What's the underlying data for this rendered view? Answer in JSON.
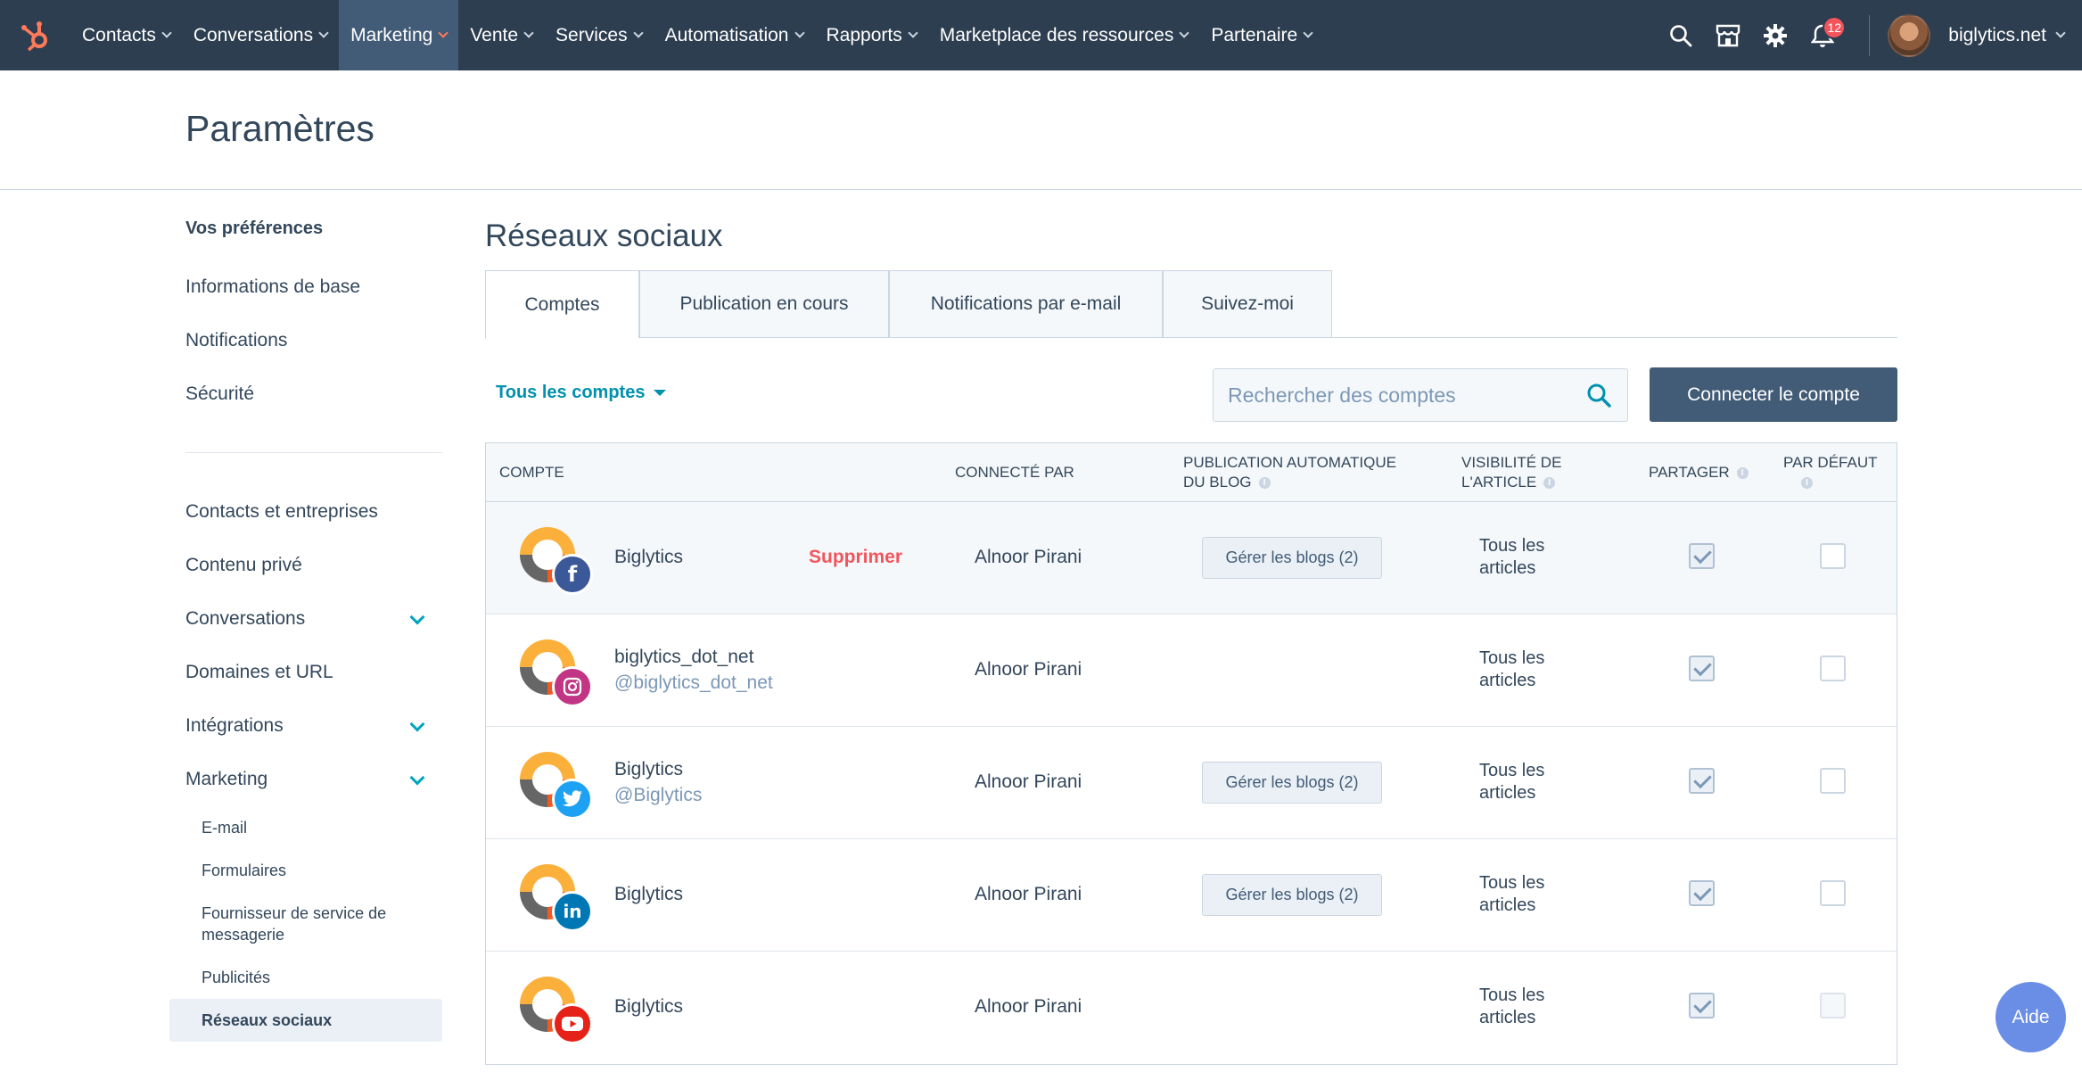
{
  "topnav": {
    "items": [
      {
        "label": "Contacts"
      },
      {
        "label": "Conversations"
      },
      {
        "label": "Marketing"
      },
      {
        "label": "Vente"
      },
      {
        "label": "Services"
      },
      {
        "label": "Automatisation"
      },
      {
        "label": "Rapports"
      },
      {
        "label": "Marketplace des ressources"
      },
      {
        "label": "Partenaire"
      }
    ],
    "active_item": "Marketing",
    "notification_count": "12",
    "account_name": "biglytics.net"
  },
  "header": {
    "title": "Paramètres"
  },
  "sidebar": {
    "section_title": "Vos préférences",
    "items": [
      {
        "label": "Informations de base"
      },
      {
        "label": "Notifications"
      },
      {
        "label": "Sécurité"
      },
      {
        "label": "Contacts et entreprises"
      },
      {
        "label": "Contenu privé"
      },
      {
        "label": "Conversations"
      },
      {
        "label": "Domaines et URL"
      },
      {
        "label": "Intégrations"
      },
      {
        "label": "Marketing"
      }
    ],
    "sub_items": [
      {
        "label": "E-mail"
      },
      {
        "label": "Formulaires"
      },
      {
        "label": "Fournisseur de service de messagerie"
      },
      {
        "label": "Publicités"
      },
      {
        "label": "Réseaux sociaux"
      }
    ],
    "active_sub_item": "Réseaux sociaux"
  },
  "main": {
    "section_title": "Réseaux sociaux",
    "tabs": [
      {
        "label": "Comptes"
      },
      {
        "label": "Publication en cours"
      },
      {
        "label": "Notifications par e-mail"
      },
      {
        "label": "Suivez-moi"
      }
    ],
    "active_tab": "Comptes",
    "filter_label": "Tous les comptes",
    "search_placeholder": "Rechercher des comptes",
    "connect_button": "Connecter le compte",
    "table": {
      "headers": {
        "account": "COMPTE",
        "connected_by": "CONNECTÉ PAR",
        "auto_publish_line1": "PUBLICATION AUTOMATIQUE",
        "auto_publish_line2": "DU BLOG",
        "visibility_line1": "VISIBILITÉ DE",
        "visibility_line2": "L'ARTICLE",
        "share": "PARTAGER",
        "default": "PAR DÉFAUT"
      },
      "rows": [
        {
          "network": "facebook",
          "name": "Biglytics",
          "handle": "",
          "remove": "Supprimer",
          "connected_by": "Alnoor Pirani",
          "blogs": "Gérer les blogs (2)",
          "visibility_line1": "Tous les",
          "visibility_line2": "articles",
          "share": true,
          "default": false
        },
        {
          "network": "instagram",
          "name": "biglytics_dot_net",
          "handle": "@biglytics_dot_net",
          "remove": "",
          "connected_by": "Alnoor Pirani",
          "blogs": "",
          "visibility_line1": "Tous les",
          "visibility_line2": "articles",
          "share": true,
          "default": false
        },
        {
          "network": "twitter",
          "name": "Biglytics",
          "handle": "@Biglytics",
          "remove": "",
          "connected_by": "Alnoor Pirani",
          "blogs": "Gérer les blogs (2)",
          "visibility_line1": "Tous les",
          "visibility_line2": "articles",
          "share": true,
          "default": false
        },
        {
          "network": "linkedin",
          "name": "Biglytics",
          "handle": "",
          "remove": "",
          "connected_by": "Alnoor Pirani",
          "blogs": "Gérer les blogs (2)",
          "visibility_line1": "Tous les",
          "visibility_line2": "articles",
          "share": true,
          "default": false
        },
        {
          "network": "youtube",
          "name": "Biglytics",
          "handle": "",
          "remove": "",
          "connected_by": "Alnoor Pirani",
          "blogs": "",
          "visibility_line1": "Tous les",
          "visibility_line2": "articles",
          "share": true,
          "default": false
        }
      ]
    }
  },
  "help_button": "Aide",
  "colors": {
    "nav_bg": "#2d3e50",
    "accent": "#ff7a59",
    "link": "#0091ae",
    "danger": "#f2545b",
    "primary_button": "#425b76",
    "facebook": "#3b5998",
    "instagram": "#c13584",
    "twitter": "#1da1f2",
    "linkedin": "#0077b5",
    "youtube": "#e62117"
  }
}
